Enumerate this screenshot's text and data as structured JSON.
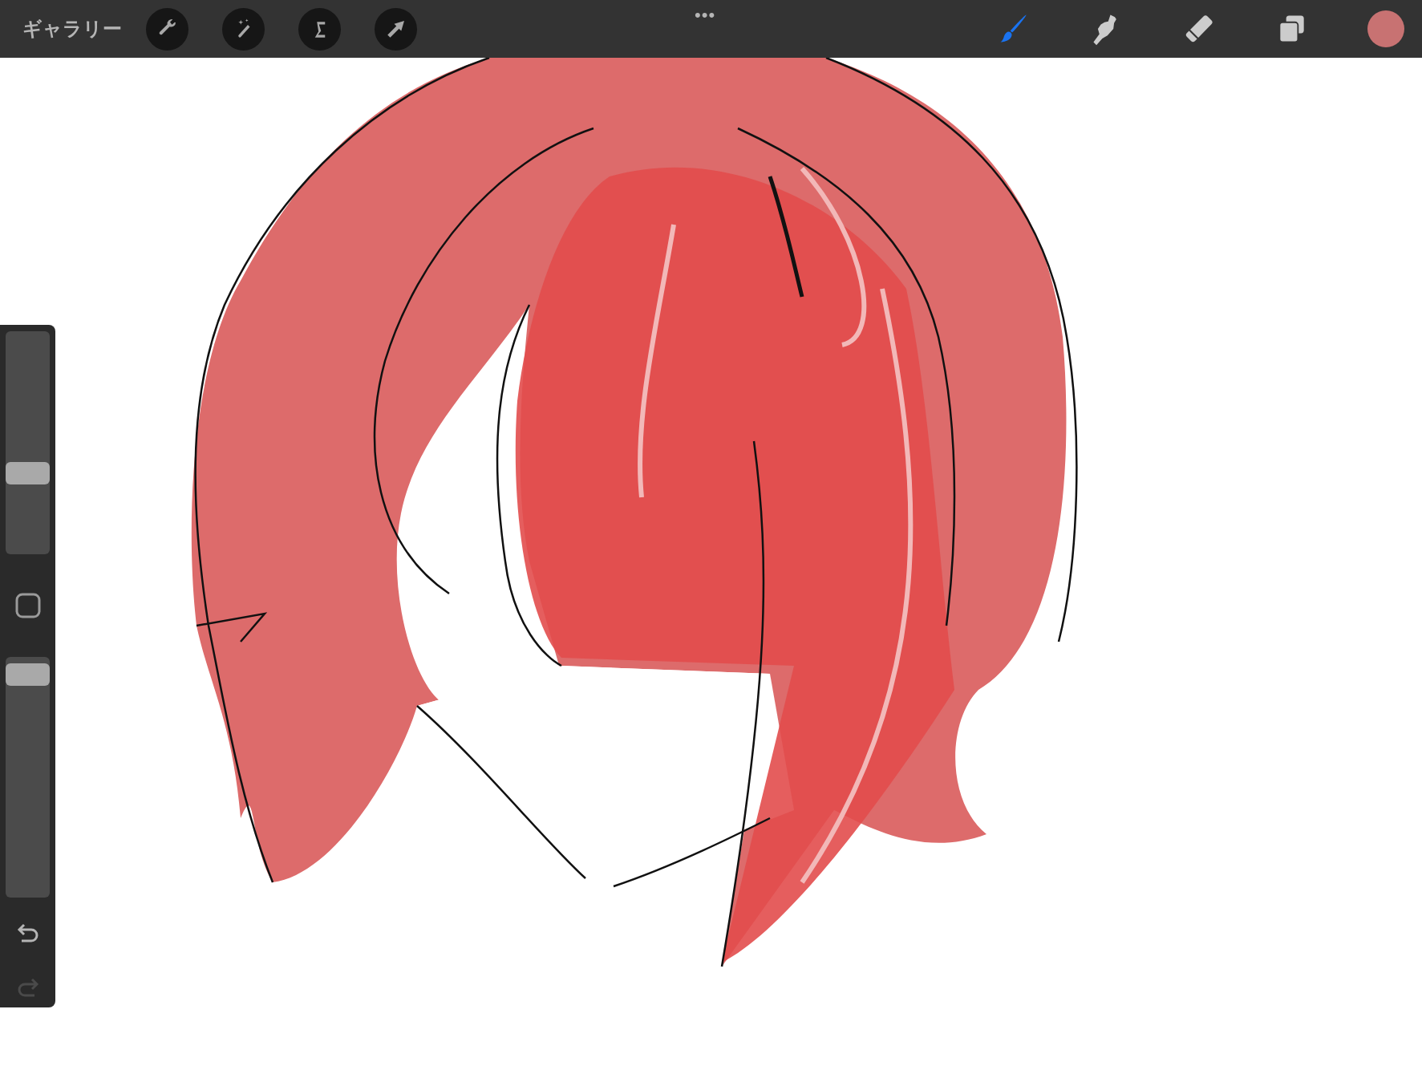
{
  "top_bar": {
    "gallery": "ギャラリー",
    "menu": "•••",
    "left_tools": [
      {
        "kind": "wrench"
      },
      {
        "kind": "wand"
      },
      {
        "kind": "selection"
      },
      {
        "kind": "arrow"
      }
    ],
    "right_tools": [
      {
        "kind": "brush",
        "selected": true
      },
      {
        "kind": "smudge",
        "selected": false
      },
      {
        "kind": "eraser",
        "selected": false
      },
      {
        "kind": "layers",
        "selected": false
      }
    ],
    "color": "#c87272"
  },
  "sidebar": {
    "size_slider": {
      "level": 0.35
    },
    "opacity_slider": {
      "level": 0.97
    },
    "undo": {
      "disabled": false
    },
    "redo": {
      "disabled": true
    }
  }
}
